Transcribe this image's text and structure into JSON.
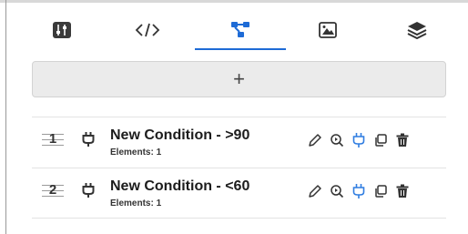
{
  "tabs": [
    {
      "icon": "sliders-icon",
      "active": false
    },
    {
      "icon": "code-icon",
      "label": "</>",
      "active": false
    },
    {
      "icon": "graph-nodes-icon",
      "active": true
    },
    {
      "icon": "image-icon",
      "active": false
    },
    {
      "icon": "layers-icon",
      "active": false
    }
  ],
  "add_button": {
    "label": "+"
  },
  "conditions": [
    {
      "index": "1",
      "title": "New Condition - >90",
      "subtitle": "Elements: 1"
    },
    {
      "index": "2",
      "title": "New Condition - <60",
      "subtitle": "Elements: 1"
    }
  ],
  "colors": {
    "accent": "#1e6bd6",
    "plug_active": "#2f7de1",
    "icon_dark": "#333333",
    "add_bar_bg": "#ebebeb"
  }
}
